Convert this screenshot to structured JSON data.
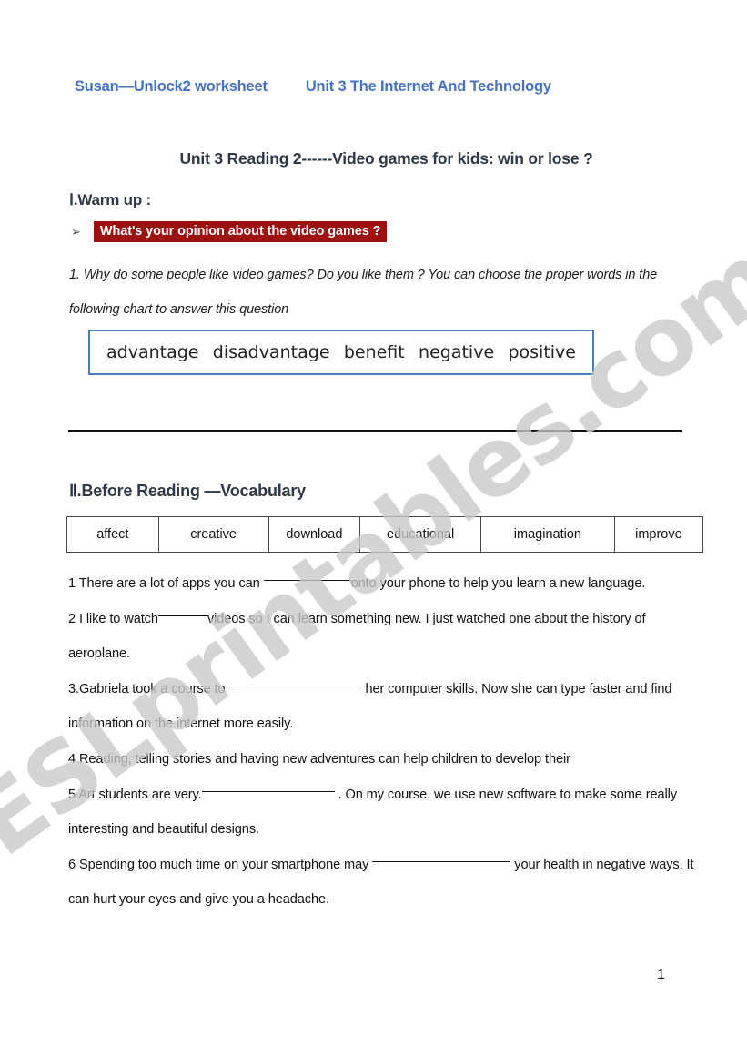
{
  "header": {
    "author_line": "Susan—Unlock2 worksheet",
    "unit_line": "Unit 3 The Internet And Technology"
  },
  "title": "Unit 3 Reading 2------Video games for kids: win or lose ?",
  "watermark": "ESLprintables.com",
  "warm_up": {
    "heading": "Ⅰ.Warm up :",
    "bullet_icon": "➢",
    "question": "What's your opinion about the video games ?",
    "instruction": "1. Why do some people like video games? Do you like them ? You can choose the proper words in the following chart to answer this question",
    "word_bank": [
      "advantage",
      "disadvantage",
      "benefit",
      "negative",
      "positive"
    ]
  },
  "before_reading": {
    "heading": "Ⅱ.Before Reading —Vocabulary",
    "vocab_words": [
      "affect",
      "creative",
      "download",
      "educational",
      "imagination",
      "improve"
    ],
    "exercises": [
      {
        "number": "1",
        "parts": [
          {
            "type": "text",
            "value": "1 There are a lot of apps you can "
          },
          {
            "type": "blank",
            "size": "md"
          },
          {
            "type": "text",
            "value": "onto your phone to help you learn a new language."
          }
        ]
      },
      {
        "number": "2",
        "parts": [
          {
            "type": "text",
            "value": "2 I like to watch"
          },
          {
            "type": "blank",
            "size": "sm"
          },
          {
            "type": "text",
            "value": "videos so I can learn something new. I just watched one about the history of aeroplane."
          }
        ]
      },
      {
        "number": "3",
        "parts": [
          {
            "type": "text",
            "value": "3.Gabriela took a course to  "
          },
          {
            "type": "blank",
            "size": "lg"
          },
          {
            "type": "text",
            "value": " her computer skills. Now she can type faster and find information on the internet more easily."
          }
        ]
      },
      {
        "number": "4",
        "parts": [
          {
            "type": "text",
            "value": "4 Reading, telling stories and having new adventures can help children to develop   their"
          }
        ]
      },
      {
        "number": "5",
        "parts": [
          {
            "type": "text",
            "value": "5 Art students are very."
          },
          {
            "type": "blank",
            "size": "lg"
          },
          {
            "type": "text",
            "value": " . On my course, we use new software to make some really interesting and beautiful designs."
          }
        ]
      },
      {
        "number": "6",
        "parts": [
          {
            "type": "text",
            "value": "6 Spending too much time on your smartphone may "
          },
          {
            "type": "blank",
            "size": "xl"
          },
          {
            "type": "text",
            "value": " your health in negative ways. It can hurt your eyes and give you a headache."
          }
        ]
      }
    ]
  },
  "page_number": "1",
  "colors": {
    "header_blue": "#4472c4",
    "heading_slate": "#2f3847",
    "highlight_red": "#9e1111",
    "box_border_blue": "#4a7ebb",
    "watermark_gray": "#c9c9c9"
  }
}
